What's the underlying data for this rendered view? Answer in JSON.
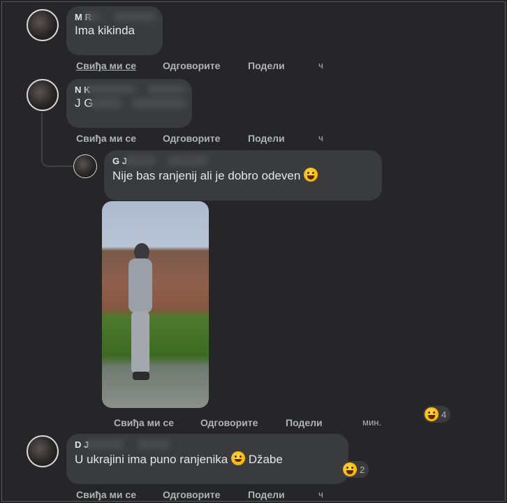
{
  "comments": [
    {
      "author": "M R",
      "text": "Ima kikinda",
      "actions": {
        "like": "Свиђа ми се",
        "reply": "Одговорите",
        "share": "Подели",
        "time": "ч"
      }
    },
    {
      "author": "N K",
      "text": "J G",
      "actions": {
        "like": "Свиђа ми се",
        "reply": "Одговорите",
        "share": "Подели",
        "time": "ч"
      }
    },
    {
      "author": "G J",
      "text": "Nije bas ranjenij ali je dobro odeven",
      "reaction_count": "4",
      "actions": {
        "like": "Свиђа ми се",
        "reply": "Одговорите",
        "share": "Подели",
        "time": "мин."
      }
    },
    {
      "author": "D J",
      "text": "U ukrajini ima puno ranjenika",
      "text_after": "Džabe",
      "reaction_count": "2",
      "actions": {
        "like": "Свиђа ми се",
        "reply": "Одговорите",
        "share": "Подели",
        "time": "ч"
      }
    }
  ],
  "icons": {
    "reaction": "laughing-emoji-icon",
    "inline": "smile-emoji-icon"
  },
  "colors": {
    "background": "#262628",
    "bubble": "#3a3b3c",
    "text": "#e4e6eb",
    "muted": "#b0b3b8"
  }
}
